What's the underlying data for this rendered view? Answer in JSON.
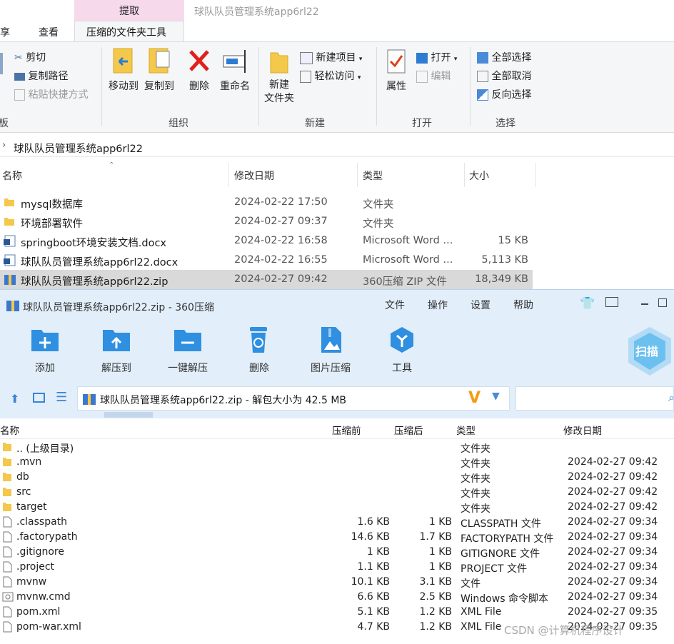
{
  "explorer": {
    "context_tab": "提取",
    "window_title": "球队队员管理系统app6rl22",
    "tabs": [
      "共享",
      "查看",
      "压缩的文件夹工具"
    ],
    "ribbon": {
      "clipboard": {
        "cut": "剪切",
        "copy_path": "复制路径",
        "paste_shortcut": "粘贴快捷方式",
        "label_partial": "板"
      },
      "organize": {
        "move_to": "移动到",
        "copy_to": "复制到",
        "delete": "删除",
        "rename": "重命名",
        "label": "组织"
      },
      "new": {
        "new_folder": "新建\n文件夹",
        "new_item": "新建项目",
        "easy_access": "轻松访问",
        "label": "新建"
      },
      "open": {
        "properties": "属性",
        "open": "打开",
        "edit": "编辑",
        "label": "打开"
      },
      "select": {
        "select_all": "全部选择",
        "select_none": "全部取消",
        "invert": "反向选择",
        "label": "选择"
      }
    },
    "address": "球队队员管理系统app6rl22",
    "columns": [
      "名称",
      "修改日期",
      "类型",
      "大小"
    ],
    "files": [
      {
        "name": "mysql数据库",
        "date": "2024-02-22 17:50",
        "type": "文件夹",
        "size": "",
        "icon": "folder-icon"
      },
      {
        "name": "环境部署软件",
        "date": "2024-02-27 09:37",
        "type": "文件夹",
        "size": "",
        "icon": "folder-icon"
      },
      {
        "name": "springboot环境安装文档.docx",
        "date": "2024-02-22 16:58",
        "type": "Microsoft Word ...",
        "size": "15 KB",
        "icon": "word-doc-icon"
      },
      {
        "name": "球队队员管理系统app6rl22.docx",
        "date": "2024-02-22 16:55",
        "type": "Microsoft Word ...",
        "size": "5,113 KB",
        "icon": "word-doc-icon"
      },
      {
        "name": "球队队员管理系统app6rl22.zip",
        "date": "2024-02-27 09:42",
        "type": "360压缩 ZIP 文件",
        "size": "18,349 KB",
        "icon": "zip-icon"
      }
    ]
  },
  "zip": {
    "title": "球队队员管理系统app6rl22.zip - 360压缩",
    "menu": [
      "文件",
      "操作",
      "设置",
      "帮助"
    ],
    "toolbar": [
      "添加",
      "解压到",
      "一键解压",
      "删除",
      "图片压缩",
      "工具"
    ],
    "scan_label": "扫描",
    "path": "球队队员管理系统app6rl22.zip - 解包大小为 42.5 MB",
    "columns": [
      "名称",
      "压缩前",
      "压缩后",
      "类型",
      "修改日期"
    ],
    "rows": [
      {
        "name": ".. (上级目录)",
        "before": "",
        "after": "",
        "type": "文件夹",
        "date": "",
        "icon": "folder-icon"
      },
      {
        "name": ".mvn",
        "before": "",
        "after": "",
        "type": "文件夹",
        "date": "2024-02-27 09:42",
        "icon": "folder-icon"
      },
      {
        "name": "db",
        "before": "",
        "after": "",
        "type": "文件夹",
        "date": "2024-02-27 09:42",
        "icon": "folder-icon"
      },
      {
        "name": "src",
        "before": "",
        "after": "",
        "type": "文件夹",
        "date": "2024-02-27 09:42",
        "icon": "folder-icon"
      },
      {
        "name": "target",
        "before": "",
        "after": "",
        "type": "文件夹",
        "date": "2024-02-27 09:42",
        "icon": "folder-icon"
      },
      {
        "name": ".classpath",
        "before": "1.6 KB",
        "after": "1 KB",
        "type": "CLASSPATH 文件",
        "date": "2024-02-27 09:34",
        "icon": "file-icon"
      },
      {
        "name": ".factorypath",
        "before": "14.6 KB",
        "after": "1.7 KB",
        "type": "FACTORYPATH 文件",
        "date": "2024-02-27 09:34",
        "icon": "file-icon"
      },
      {
        "name": ".gitignore",
        "before": "1 KB",
        "after": "1 KB",
        "type": "GITIGNORE 文件",
        "date": "2024-02-27 09:34",
        "icon": "file-icon"
      },
      {
        "name": ".project",
        "before": "1.1 KB",
        "after": "1 KB",
        "type": "PROJECT 文件",
        "date": "2024-02-27 09:34",
        "icon": "file-icon"
      },
      {
        "name": "mvnw",
        "before": "10.1 KB",
        "after": "3.1 KB",
        "type": "文件",
        "date": "2024-02-27 09:34",
        "icon": "file-icon"
      },
      {
        "name": "mvnw.cmd",
        "before": "6.6 KB",
        "after": "2.5 KB",
        "type": "Windows 命令脚本",
        "date": "2024-02-27 09:34",
        "icon": "cmd-script-icon"
      },
      {
        "name": "pom.xml",
        "before": "5.1 KB",
        "after": "1.2 KB",
        "type": "XML File",
        "date": "2024-02-27 09:35",
        "icon": "file-icon"
      },
      {
        "name": "pom-war.xml",
        "before": "4.7 KB",
        "after": "1.2 KB",
        "type": "XML File",
        "date": "2024-02-27 09:35",
        "icon": "file-icon"
      }
    ]
  },
  "watermark": "CSDN @计算机程序设计"
}
